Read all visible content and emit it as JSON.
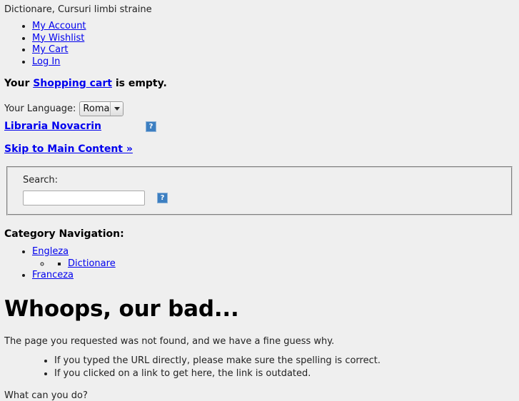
{
  "header": {
    "tagline": "Dictionare, Cursuri limbi straine"
  },
  "account_links": [
    {
      "label": "My Account"
    },
    {
      "label": "My Wishlist"
    },
    {
      "label": "My Cart"
    },
    {
      "label": "Log In"
    }
  ],
  "cart": {
    "prefix": "Your",
    "link_label": "Shopping cart",
    "suffix": "is empty."
  },
  "language": {
    "label": "Your Language:",
    "selected": "Romana",
    "options": [
      "Romana"
    ]
  },
  "logo": {
    "label": "Libraria Novacrin",
    "icon": "broken-image-icon"
  },
  "skip": {
    "label": "Skip to Main Content »"
  },
  "search": {
    "legend": "Search:",
    "value": "",
    "placeholder": "",
    "button_icon": "broken-image-icon"
  },
  "category_navigation": {
    "heading": "Category Navigation:",
    "items": [
      {
        "label": "Engleza",
        "children": [
          {
            "label": "",
            "children": [
              {
                "label": "Dictionare"
              }
            ]
          }
        ]
      },
      {
        "label": "Franceza"
      }
    ]
  },
  "main": {
    "title": "Whoops, our bad...",
    "intro": "The page you requested was not found, and we have a fine guess why.",
    "reasons": [
      "If you typed the URL directly, please make sure the spelling is correct.",
      "If you clicked on a link to get here, the link is outdated."
    ],
    "what_can_you_do": "What can you do?"
  },
  "colors": {
    "page_background": "#efefef",
    "link": "#0000ee",
    "text": "#222222",
    "broken_icon": "#3d7fc1"
  }
}
